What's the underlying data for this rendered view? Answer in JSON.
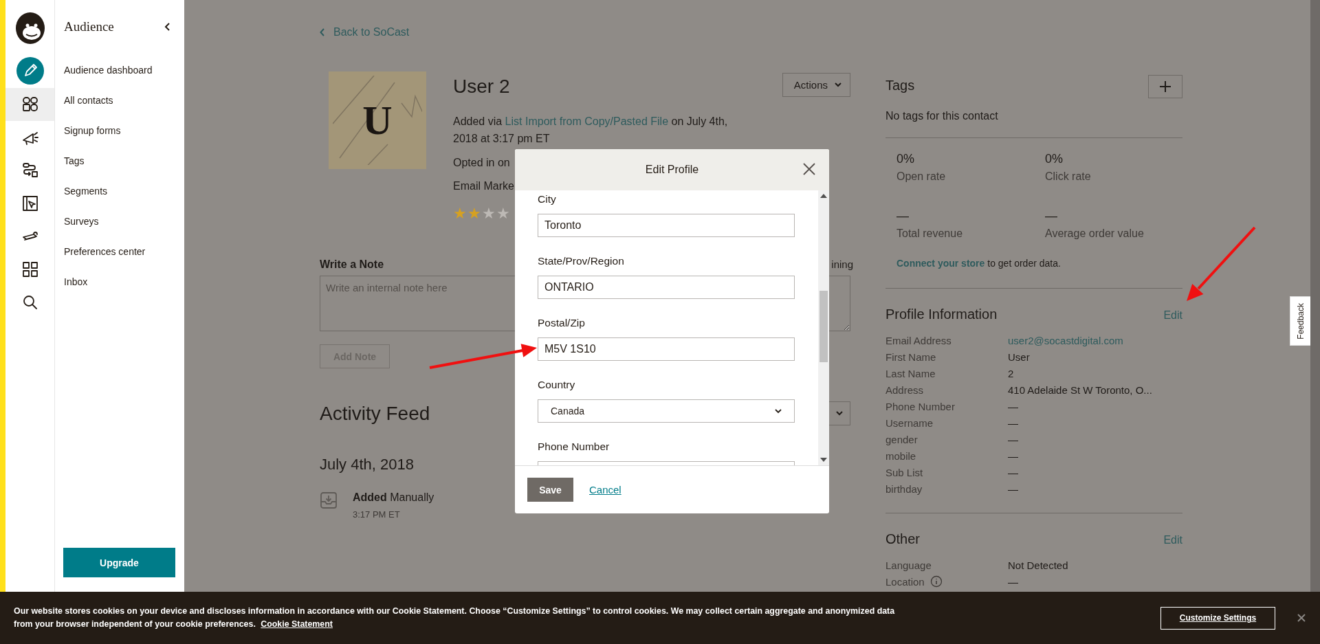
{
  "sidebar": {
    "rail_items": [
      {
        "kind": "create",
        "selected": false
      },
      {
        "kind": "audience",
        "selected": true
      },
      {
        "kind": "campaigns",
        "selected": false
      },
      {
        "kind": "automations",
        "selected": false
      },
      {
        "kind": "website",
        "selected": false
      },
      {
        "kind": "content",
        "selected": false
      },
      {
        "kind": "integrations",
        "selected": false
      },
      {
        "kind": "search",
        "selected": false
      }
    ]
  },
  "nav": {
    "title": "Audience",
    "items": [
      "Audience dashboard",
      "All contacts",
      "Signup forms",
      "Tags",
      "Segments",
      "Surveys",
      "Preferences center",
      "Inbox"
    ],
    "upgrade": "Upgrade"
  },
  "back_link": "Back to SoCast",
  "contact": {
    "initial": "U",
    "name": "User 2",
    "actions": "Actions",
    "added_before": "Added via",
    "added_link": "List Import from Copy/Pasted File",
    "added_after": "on July 4th, 2018 at 3:17 pm ET",
    "opted_in": "Opted in on",
    "email_marketing": "Email Marke",
    "stars": 2
  },
  "note": {
    "label": "Write a Note",
    "remaining": "ining",
    "placeholder": "Write an internal note here",
    "button": "Add Note"
  },
  "activity": {
    "title": "Activity Feed",
    "date": "July 4th, 2018",
    "events": [
      {
        "text": "**Added** Manually",
        "time": "3:17 PM ET"
      }
    ]
  },
  "tags": {
    "title": "Tags",
    "empty": "No tags for this contact"
  },
  "stats": [
    {
      "value": "0%",
      "label": "Open rate"
    },
    {
      "value": "0%",
      "label": "Click rate"
    },
    {
      "value": "—",
      "label": "Total revenue"
    },
    {
      "value": "—",
      "label": "Average order value"
    }
  ],
  "store_note": {
    "link": "Connect your store",
    "text": "to get order data."
  },
  "profile": {
    "title": "Profile Information",
    "edit": "Edit",
    "fields": [
      {
        "label": "Email Address",
        "value": "user2@socastdigital.com",
        "kind": "link",
        "info": false
      },
      {
        "label": "First Name",
        "value": "User",
        "kind": "text",
        "info": false
      },
      {
        "label": "Last Name",
        "value": "2",
        "kind": "text",
        "info": false
      },
      {
        "label": "Address",
        "value": "410 Adelaide St W Toronto, O...",
        "kind": "text",
        "info": false
      },
      {
        "label": "Phone Number",
        "value": "—",
        "kind": "text",
        "info": false
      },
      {
        "label": "Username",
        "value": "—",
        "kind": "text",
        "info": false
      },
      {
        "label": "gender",
        "value": "—",
        "kind": "text",
        "info": false
      },
      {
        "label": "mobile",
        "value": "—",
        "kind": "text",
        "info": false
      },
      {
        "label": "Sub List",
        "value": "—",
        "kind": "text",
        "info": false
      },
      {
        "label": "birthday",
        "value": "—",
        "kind": "text",
        "info": false
      }
    ]
  },
  "other": {
    "title": "Other",
    "edit": "Edit",
    "fields": [
      {
        "label": "Language",
        "value": "Not Detected",
        "kind": "text",
        "info": false
      },
      {
        "label": "Location",
        "value": "—",
        "kind": "text",
        "info": true
      }
    ]
  },
  "feedback": "Feedback",
  "modal": {
    "title": "Edit Profile",
    "fields": [
      {
        "label": "City",
        "value": "Toronto",
        "kind": "text"
      },
      {
        "label": "State/Prov/Region",
        "value": "ONTARIO",
        "kind": "text"
      },
      {
        "label": "Postal/Zip",
        "value": "M5V 1S10",
        "kind": "text"
      },
      {
        "label": "Country",
        "value": "Canada",
        "kind": "select"
      },
      {
        "label": "Phone Number",
        "kind": "text"
      }
    ],
    "save": "Save",
    "cancel": "Cancel"
  },
  "cookie_banner": {
    "text": "Our website stores cookies on your device and discloses information in accordance with our Cookie Statement. Choose “Customize Settings” to control cookies. We may collect certain aggregate and anonymized data from your browser independent of your cookie preferences.",
    "link": "Cookie Statement",
    "button": "Customize Settings"
  }
}
